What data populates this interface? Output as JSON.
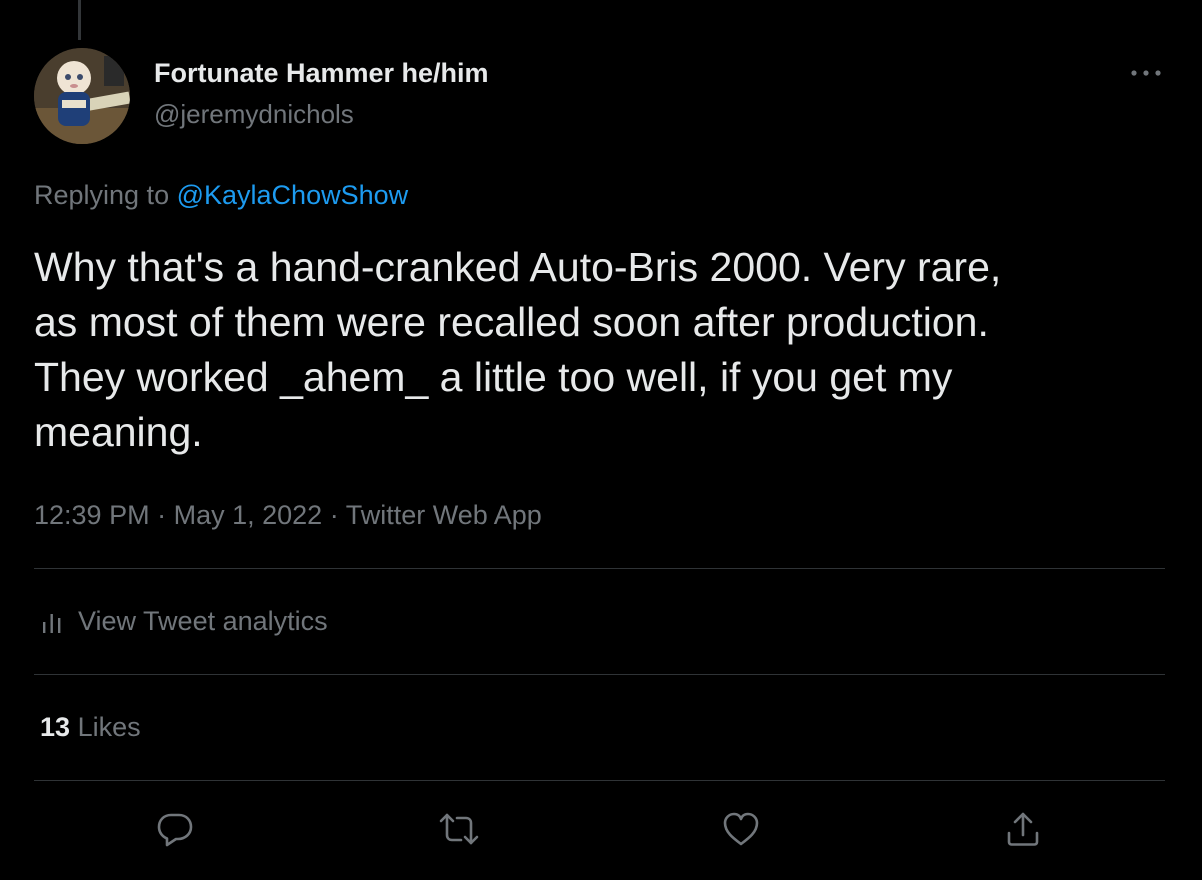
{
  "author": {
    "display_name": "Fortunate Hammer he/him",
    "handle": "@jeremydnichols"
  },
  "reply": {
    "prefix": "Replying to",
    "mention": "@KaylaChowShow"
  },
  "tweet": {
    "lines": [
      "Why that's a hand-cranked Auto-Bris 2000. Very rare,",
      "as most of them were recalled soon after production.",
      "They worked _ahem_ a little too well, if you get my",
      "meaning."
    ],
    "time": "12:39 PM",
    "date": "May 1, 2022",
    "source": "Twitter Web App",
    "separator": "·"
  },
  "analytics": {
    "label": "View Tweet analytics"
  },
  "stats": {
    "likes_count": "13",
    "likes_label": "Likes"
  },
  "icons": {
    "more": "more-horizontal-icon",
    "analytics": "bar-chart-icon",
    "reply": "reply-bubble-icon",
    "retweet": "retweet-icon",
    "like": "heart-icon",
    "share": "share-icon"
  },
  "colors": {
    "background": "#000000",
    "text": "#e7e9ea",
    "secondary": "#71767b",
    "accent": "#1d9bf0",
    "divider": "#2f3336"
  }
}
